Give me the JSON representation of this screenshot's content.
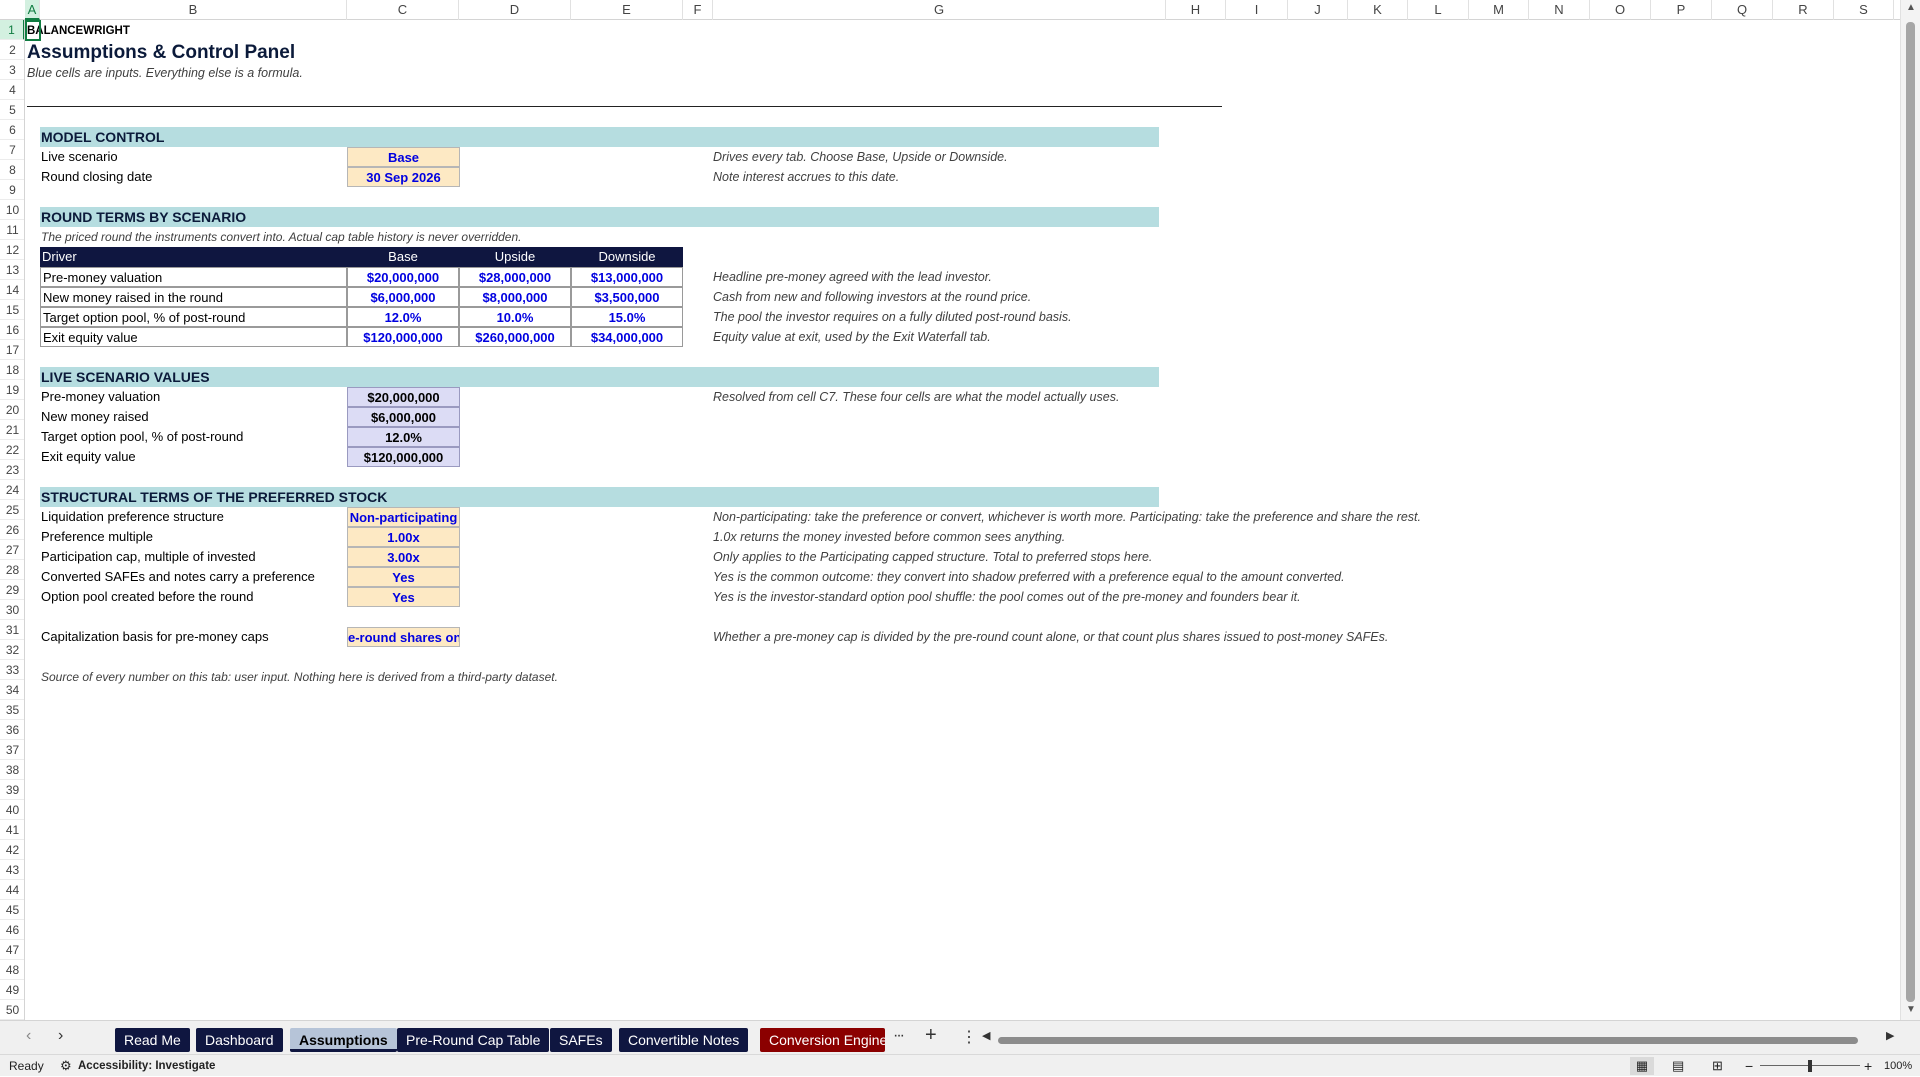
{
  "columns": [
    "A",
    "B",
    "C",
    "D",
    "E",
    "F",
    "G",
    "H",
    "I",
    "J",
    "K",
    "L",
    "M",
    "N",
    "O",
    "P",
    "Q",
    "R",
    "S"
  ],
  "rows": [
    1,
    2,
    3,
    4,
    5,
    6,
    7,
    8,
    9,
    10,
    11,
    12,
    13,
    14,
    15,
    16,
    17,
    18,
    19,
    20,
    21,
    22,
    23,
    24,
    25,
    26,
    27,
    28,
    29,
    30,
    31,
    32,
    33,
    34,
    35,
    36,
    37,
    38,
    39,
    40,
    41,
    42,
    43,
    44,
    45,
    46,
    47,
    48,
    49,
    50
  ],
  "brand": "BALANCEWRIGHT",
  "title": "Assumptions & Control Panel",
  "subtitle": "Blue cells are inputs. Everything else is a formula.",
  "model_control": {
    "header": "MODEL CONTROL",
    "live_scenario_label": "Live scenario",
    "live_scenario_value": "Base",
    "live_scenario_note": "Drives every tab. Choose Base, Upside or Downside.",
    "closing_label": "Round closing date",
    "closing_value": "30 Sep 2026",
    "closing_note": "Note interest accrues to this date."
  },
  "round_terms": {
    "header": "ROUND TERMS BY SCENARIO",
    "intro": "The priced round the instruments convert into. Actual cap table history is never overridden.",
    "col_driver": "Driver",
    "col_base": "Base",
    "col_upside": "Upside",
    "col_downside": "Downside",
    "rows": [
      {
        "driver": "Pre-money valuation",
        "base": "$20,000,000",
        "upside": "$28,000,000",
        "downside": "$13,000,000",
        "note": "Headline pre-money agreed with the lead investor."
      },
      {
        "driver": "New money raised in the round",
        "base": "$6,000,000",
        "upside": "$8,000,000",
        "downside": "$3,500,000",
        "note": "Cash from new and following investors at the round price."
      },
      {
        "driver": "Target option pool, % of post-round",
        "base": "12.0%",
        "upside": "10.0%",
        "downside": "15.0%",
        "note": "The pool the investor requires on a fully diluted post-round basis."
      },
      {
        "driver": "Exit equity value",
        "base": "$120,000,000",
        "upside": "$260,000,000",
        "downside": "$34,000,000",
        "note": "Equity value at exit, used by the Exit Waterfall tab."
      }
    ]
  },
  "live_values": {
    "header": "LIVE SCENARIO VALUES",
    "rows": [
      {
        "label": "Pre-money valuation",
        "value": "$20,000,000",
        "note": "Resolved from cell C7. These four cells are what the model actually uses."
      },
      {
        "label": "New money raised",
        "value": "$6,000,000",
        "note": ""
      },
      {
        "label": "Target option pool, % of post-round",
        "value": "12.0%",
        "note": ""
      },
      {
        "label": "Exit equity value",
        "value": "$120,000,000",
        "note": ""
      }
    ]
  },
  "structural": {
    "header": "STRUCTURAL TERMS OF THE PREFERRED STOCK",
    "rows": [
      {
        "label": "Liquidation preference structure",
        "value": "Non-participating",
        "note": "Non-participating: take the preference or convert, whichever is worth more. Participating: take the preference and share the rest."
      },
      {
        "label": "Preference multiple",
        "value": "1.00x",
        "note": "1.0x returns the money invested before common sees anything."
      },
      {
        "label": "Participation cap, multiple of invested",
        "value": "3.00x",
        "note": "Only applies to the Participating capped structure. Total to preferred stops here."
      },
      {
        "label": "Converted SAFEs and notes carry a preference",
        "value": "Yes",
        "note": "Yes is the common outcome: they convert into shadow preferred with a preference equal to the amount converted."
      },
      {
        "label": "Option pool created before the round",
        "value": "Yes",
        "note": "Yes is the investor-standard option pool shuffle: the pool comes out of the pre-money and founders bear it."
      }
    ],
    "cap_label": "Capitalization basis for pre-money caps",
    "cap_value": "e-round shares only",
    "cap_note": "Whether a pre-money cap is divided by the pre-round count alone, or that count plus shares issued to post-money SAFEs."
  },
  "source_note": "Source of every number on this tab: user input. Nothing here is derived from a third-party dataset.",
  "tabs": [
    {
      "label": "Read Me"
    },
    {
      "label": "Dashboard"
    },
    {
      "label": "Assumptions"
    },
    {
      "label": "Pre-Round Cap Table"
    },
    {
      "label": "SAFEs"
    },
    {
      "label": "Convertible Notes"
    },
    {
      "label": "Conversion Engine"
    }
  ],
  "status": {
    "ready": "Ready",
    "accessibility": "Accessibility: Investigate",
    "zoom": "100%"
  },
  "colors": {
    "input_fill": "#fde9c4",
    "input_text": "#0000e0",
    "band": "#b6dde0",
    "header_dark": "#0f1640",
    "tab_red": "#8b0000"
  }
}
